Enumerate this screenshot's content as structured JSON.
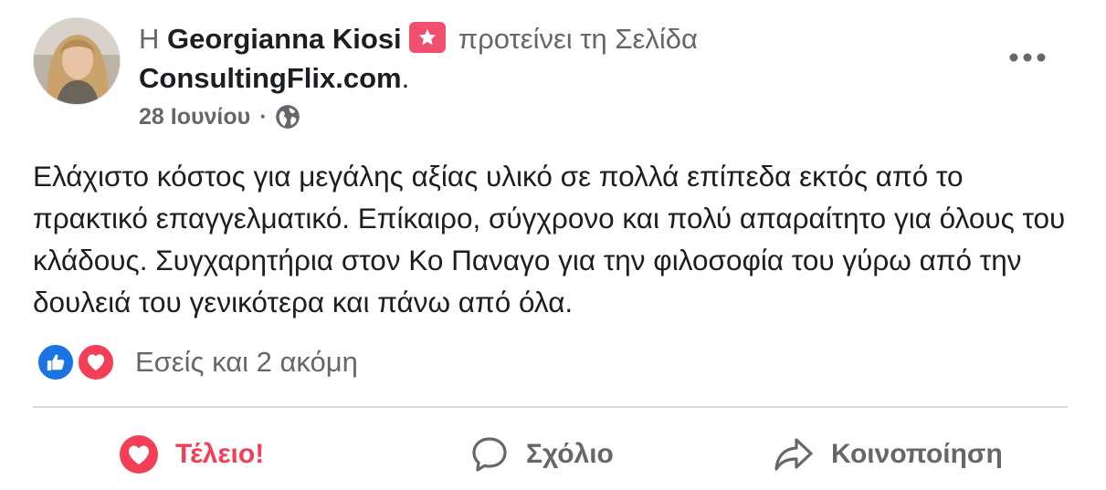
{
  "post": {
    "author_prefix": "Η",
    "author_name": "Georgianna Kiosi",
    "recommends_text": "προτείνει τη Σελίδα",
    "page_name": "ConsultingFlix.com",
    "page_suffix": ".",
    "date": "28 Ιουνίου",
    "separator": "·",
    "privacy_icon": "globe-icon",
    "more_icon": "more-options-icon",
    "body_text": "Ελάχιστο κόστος για μεγάλης αξίας υλικό σε πολλά επίπεδα εκτός από το πρακτικό επαγγελματικό. Επίκαιρο, σύγχρονο και πολύ απαραίτητο για όλους του κλάδους. Συγχαρητήρια στον Κο Παναγο για την φιλοσοφία του γύρω από την δουλειά του γενικότερα και πάνω από όλα."
  },
  "reactions": {
    "summary": "Εσείς και 2 ακόμη",
    "icons": [
      "like-reaction-icon",
      "love-reaction-icon"
    ]
  },
  "actions": {
    "like_label": "Τέλειο!",
    "comment_label": "Σχόλιο",
    "share_label": "Κοινοποίηση"
  },
  "colors": {
    "love": "#f33e58",
    "like": "#1b74e4",
    "muted": "#65676b",
    "text": "#1c1e21",
    "badge": "#f0506e"
  }
}
